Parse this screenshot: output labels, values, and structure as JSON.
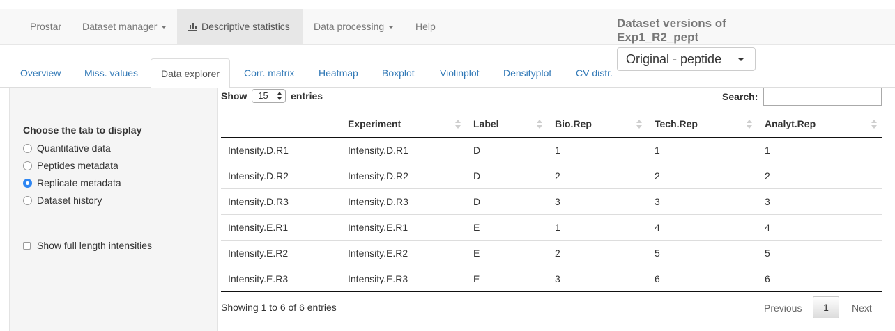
{
  "navbar": {
    "items": [
      {
        "label": "Prostar"
      },
      {
        "label": "Dataset manager"
      },
      {
        "label": "Descriptive statistics"
      },
      {
        "label": "Data processing"
      },
      {
        "label": "Help"
      }
    ],
    "active_index": 2
  },
  "versions": {
    "title": "Dataset versions of Exp1_R2_pept",
    "selected": "Original - peptide"
  },
  "tabs": [
    {
      "label": "Overview"
    },
    {
      "label": "Miss. values"
    },
    {
      "label": "Data explorer"
    },
    {
      "label": "Corr. matrix"
    },
    {
      "label": "Heatmap"
    },
    {
      "label": "Boxplot"
    },
    {
      "label": "Violinplot"
    },
    {
      "label": "Densityplot"
    },
    {
      "label": "CV distr."
    }
  ],
  "active_tab": "Data explorer",
  "sidebar": {
    "title": "Choose the tab to display",
    "options": [
      {
        "label": "Quantitative data",
        "selected": false
      },
      {
        "label": "Peptides metadata",
        "selected": false
      },
      {
        "label": "Replicate metadata",
        "selected": true
      },
      {
        "label": "Dataset history",
        "selected": false
      }
    ],
    "checkbox_label": "Show full length intensities",
    "checkbox_checked": false
  },
  "table_controls": {
    "show_label": "Show",
    "entries_value": "15",
    "entries_label": "entries",
    "search_label": "Search:",
    "search_value": ""
  },
  "table": {
    "headers": [
      "",
      "Experiment",
      "Label",
      "Bio.Rep",
      "Tech.Rep",
      "Analyt.Rep"
    ],
    "rows": [
      [
        "Intensity.D.R1",
        "Intensity.D.R1",
        "D",
        "1",
        "1",
        "1"
      ],
      [
        "Intensity.D.R2",
        "Intensity.D.R2",
        "D",
        "2",
        "2",
        "2"
      ],
      [
        "Intensity.D.R3",
        "Intensity.D.R3",
        "D",
        "3",
        "3",
        "3"
      ],
      [
        "Intensity.E.R1",
        "Intensity.E.R1",
        "E",
        "1",
        "4",
        "4"
      ],
      [
        "Intensity.E.R2",
        "Intensity.E.R2",
        "E",
        "2",
        "5",
        "5"
      ],
      [
        "Intensity.E.R3",
        "Intensity.E.R3",
        "E",
        "3",
        "6",
        "6"
      ]
    ]
  },
  "footer": {
    "info": "Showing 1 to 6 of 6 entries",
    "prev_label": "Previous",
    "current_page": "1",
    "next_label": "Next"
  }
}
